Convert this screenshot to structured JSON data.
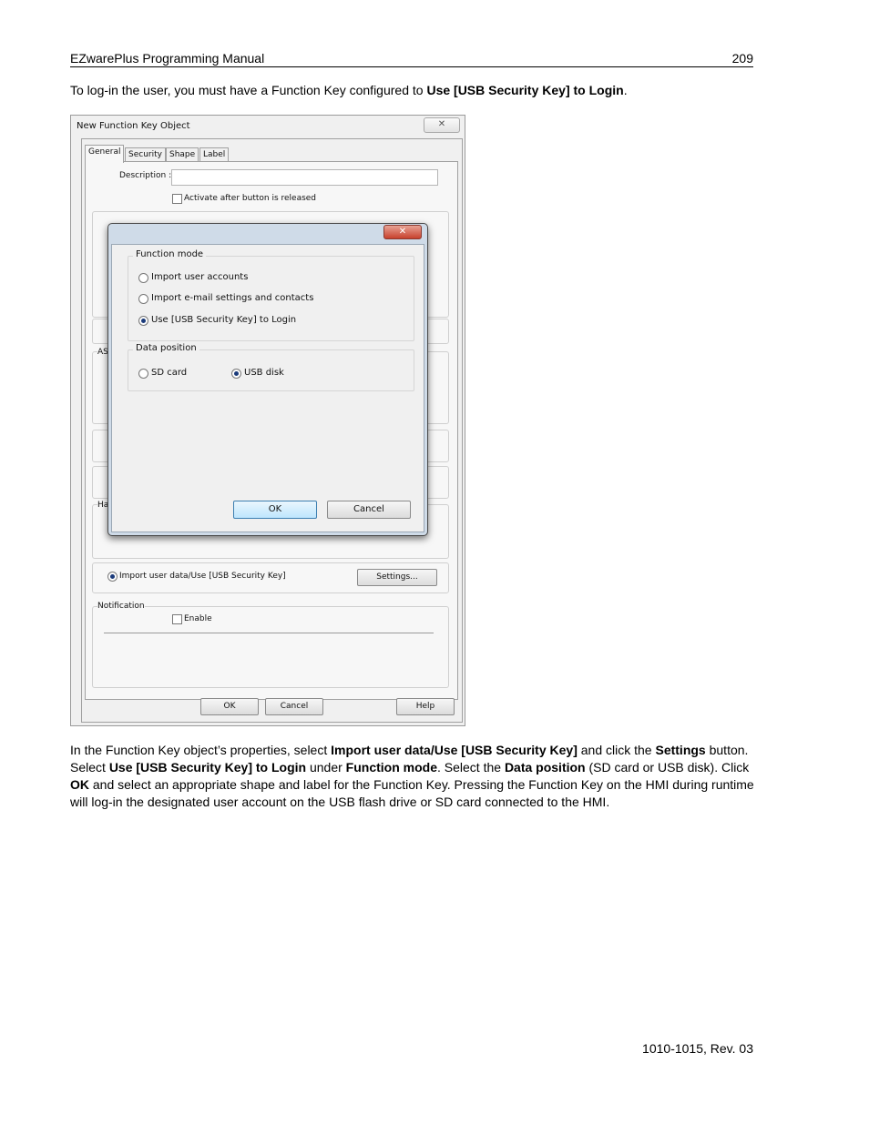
{
  "header": {
    "title": "EZwarePlus Programming Manual",
    "page": "209"
  },
  "intro": {
    "before": "To log-in the user, you must have a Function Key configured to ",
    "bold": "Use [USB Security Key] to Login",
    "after": "."
  },
  "screenshot": {
    "window_title": "New  Function Key Object",
    "close_glyph": "✕",
    "tabs": [
      "General",
      "Security",
      "Shape",
      "Label"
    ],
    "description_label": "Description :",
    "activate_label": "Activate after button is released",
    "partial_labels": {
      "a": "AS",
      "b": "Ha"
    },
    "import_radio_label": "Import user data/Use [USB Security Key]",
    "settings_button": "Settings...",
    "notification": {
      "title": "Notification",
      "enable_label": "Enable"
    },
    "buttons": {
      "ok": "OK",
      "cancel": "Cancel",
      "help": "Help"
    },
    "dialog": {
      "close_glyph": "✕",
      "function_mode": {
        "title": "Function mode",
        "options": [
          "Import user accounts",
          "Import  e-mail settings and contacts",
          "Use [USB Security Key] to Login"
        ],
        "selected": 2
      },
      "data_position": {
        "title": "Data position",
        "options": [
          "SD card",
          "USB disk"
        ],
        "selected": 1
      },
      "ok": "OK",
      "cancel": "Cancel"
    }
  },
  "body": {
    "p1": "In the Function Key object’s properties, select ",
    "b1": "Import user data/Use [USB Security Key]",
    "p2": " and click the ",
    "b2": "Settings",
    "p3": " button. Select ",
    "b3": "Use [USB Security Key] to Login",
    "p4": " under ",
    "b4": "Function mode",
    "p5": ". Select the ",
    "b5": "Data position",
    "p6": " (SD card or USB disk). Click ",
    "b6": "OK",
    "p7": " and select an appropriate shape and label for the Function Key. Pressing the Function Key on the HMI during runtime will log-in the designated user account on the USB flash drive or SD card connected to the HMI."
  },
  "footer": "1010-1015, Rev. 03"
}
